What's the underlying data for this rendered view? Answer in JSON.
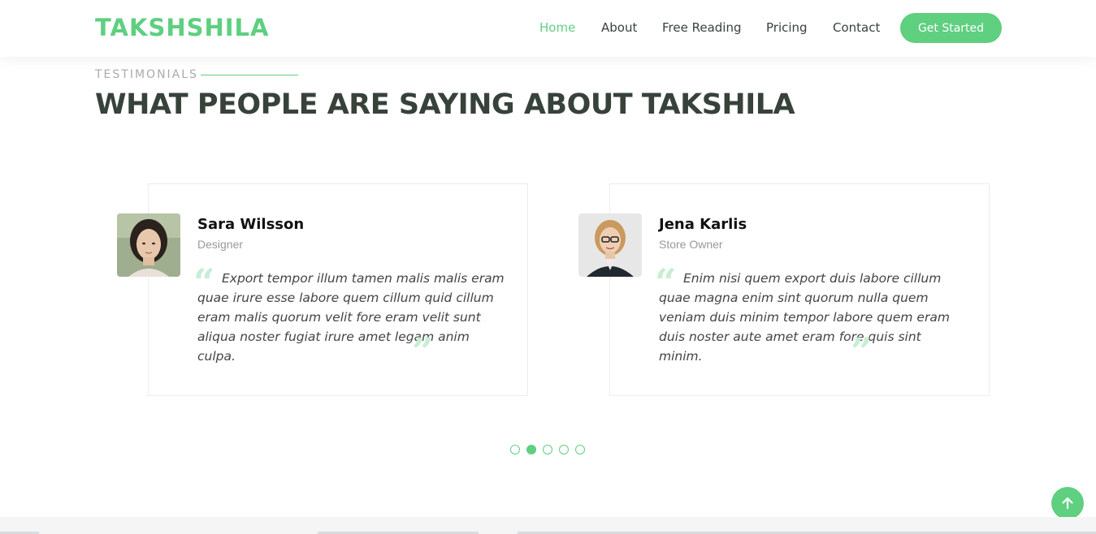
{
  "header": {
    "logo": "TAKSHSHILA",
    "nav": [
      {
        "label": "Home",
        "active": true
      },
      {
        "label": "About",
        "active": false
      },
      {
        "label": "Free Reading",
        "active": false
      },
      {
        "label": "Pricing",
        "active": false
      },
      {
        "label": "Contact",
        "active": false
      }
    ],
    "cta_label": "Get Started"
  },
  "section": {
    "eyebrow": "TESTIMONIALS",
    "title": "WHAT PEOPLE ARE SAYING ABOUT TAKSHILA"
  },
  "testimonials": [
    {
      "name": "Sara Wilsson",
      "role": "Designer",
      "quote": "Export tempor illum tamen malis malis eram quae irure esse labore quem cillum quid cillum eram malis quorum velit fore eram velit sunt aliqua noster fugiat irure amet legam anim culpa."
    },
    {
      "name": "Jena Karlis",
      "role": "Store Owner",
      "quote": "Enim nisi quem export duis labore cillum quae magna enim sint quorum nulla quem veniam duis minim tempor labore quem eram duis noster aute amet eram fore quis sint minim."
    }
  ],
  "pagination": {
    "total": 5,
    "active_index": 1
  },
  "icons": {
    "quote_open": "quote-left-icon",
    "quote_close": "quote-right-icon",
    "back_to_top": "arrow-up-icon"
  },
  "colors": {
    "accent": "#5fcf80",
    "heading": "#37423b",
    "muted": "#999999",
    "quote_icon": "#c7eed3"
  }
}
